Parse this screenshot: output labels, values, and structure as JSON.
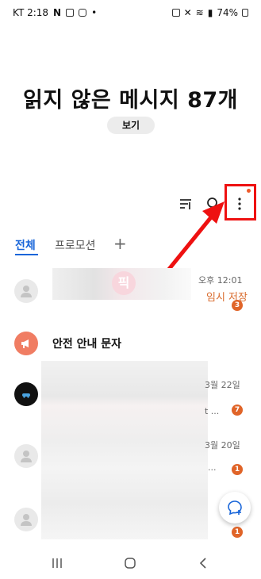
{
  "status_bar": {
    "time": "KT 2:18",
    "battery": "74%",
    "left_icons": [
      "netflix-icon",
      "cast-icon",
      "youtube-icon",
      "dot-icon"
    ],
    "right_icons": [
      "battery-saver-icon",
      "mute-icon",
      "wifi-icon",
      "signal-icon"
    ]
  },
  "header": {
    "title": "읽지 않은 메시지 87개",
    "view_button": "보기"
  },
  "toolbar": {
    "filter_icon": "filter-icon",
    "search_icon": "search-icon",
    "more_icon": "more-vertical-icon"
  },
  "tabs": [
    {
      "label": "전체",
      "active": true
    },
    {
      "label": "프로모션",
      "active": false
    }
  ],
  "tab_add": "+",
  "conversations": [
    {
      "time": "오후 12:01",
      "status": "임시 저장",
      "badge": "3",
      "avatar": "person"
    },
    {
      "name": "안전 안내 문자",
      "avatar": "megaphone"
    },
    {
      "time": "3월 22일",
      "preview_end": "t ...",
      "badge": "7",
      "avatar": "car"
    },
    {
      "time": "3월 20일",
      "preview_end": "...",
      "badge": "1",
      "avatar": "person"
    },
    {
      "badge": "1",
      "avatar": "person"
    }
  ],
  "overlay_text": "픽",
  "colors": {
    "accent": "#1865d9",
    "badge": "#e06428",
    "highlight": "#e11111"
  }
}
